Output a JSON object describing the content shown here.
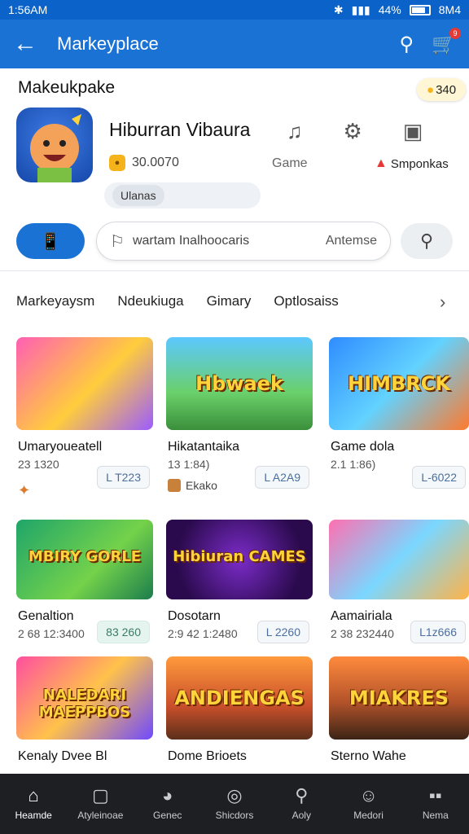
{
  "status": {
    "time": "1:56AM",
    "battery_pct": "44%",
    "label": "8M4"
  },
  "appbar": {
    "title": "Markeyplace",
    "cart_count": "9"
  },
  "header": {
    "section_title": "Makeukpake",
    "coins": "340"
  },
  "app": {
    "name": "Hiburran Vibaura",
    "rating": "30.0070",
    "category": "Game",
    "sponsor": "Smponkas",
    "tag": "Ulanas"
  },
  "search": {
    "filter_icon": "📱",
    "placeholder": "wartam Inalhoocaris",
    "option": "Antemse"
  },
  "tabs": [
    "Markeyaysm",
    "Ndeukiuga",
    "Gimary",
    "Optlosaiss"
  ],
  "cards": [
    {
      "title": "Umaryoueatell",
      "sub": "23 1320",
      "badge": "L T223",
      "extra": "",
      "art": "a1",
      "word": ""
    },
    {
      "title": "Hikatantaika",
      "sub": "13 1:84)",
      "badge": "L A2A9",
      "extra": "Ekako",
      "art": "a2",
      "word": "Hbwaek"
    },
    {
      "title": "Game dola",
      "sub": "2.1 1:86)",
      "badge": "L-6022",
      "extra": "",
      "art": "a3",
      "word": "HIMBRCK"
    },
    {
      "title": "Genaltion",
      "sub": "2 68 12:3400",
      "badge": "83 260",
      "extra": "",
      "art": "a4",
      "word": "MBIRY GORLE"
    },
    {
      "title": "Dosotarn",
      "sub": "2:9 42 1:2480",
      "badge": "L 2260",
      "extra": "",
      "art": "a5",
      "word": "Hibiuran CAMES"
    },
    {
      "title": "Aamairiala",
      "sub": "2 38 232440",
      "badge": "L1z666",
      "extra": "",
      "art": "a6",
      "word": ""
    },
    {
      "title": "Kenaly Dvee Bl",
      "sub": "",
      "badge": "",
      "extra": "",
      "art": "a7",
      "word": "NALEDARI MAEPPBOS"
    },
    {
      "title": "Dome Brioets",
      "sub": "",
      "badge": "",
      "extra": "",
      "art": "a8",
      "word": "ANDIENGAS"
    },
    {
      "title": "Sterno Wahe",
      "sub": "",
      "badge": "",
      "extra": "",
      "art": "a9",
      "word": "MIAKRES"
    }
  ],
  "nav": [
    {
      "label": "Heamde",
      "icon": "home-icon"
    },
    {
      "label": "Atyleinoae",
      "icon": "message-icon"
    },
    {
      "label": "Genec",
      "icon": "gamepad-icon"
    },
    {
      "label": "Shicdors",
      "icon": "compass-icon"
    },
    {
      "label": "Aoly",
      "icon": "search-icon"
    },
    {
      "label": "Medori",
      "icon": "profile-icon"
    },
    {
      "label": "Nema",
      "icon": "menu-icon"
    }
  ]
}
